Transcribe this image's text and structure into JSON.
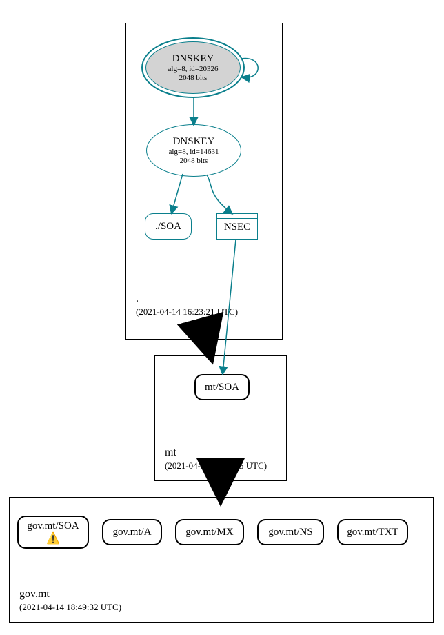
{
  "zones": {
    "root": {
      "label": ".",
      "timestamp": "(2021-04-14 16:23:21 UTC)",
      "ksk": {
        "title": "DNSKEY",
        "alg": "alg=8, id=20326",
        "bits": "2048 bits"
      },
      "zsk": {
        "title": "DNSKEY",
        "alg": "alg=8, id=14631",
        "bits": "2048 bits"
      },
      "soa": "./SOA",
      "nsec": "NSEC"
    },
    "mt": {
      "label": "mt",
      "timestamp": "(2021-04-14 18:49:25 UTC)",
      "soa": "mt/SOA"
    },
    "govmt": {
      "label": "gov.mt",
      "timestamp": "(2021-04-14 18:49:32 UTC)",
      "records": {
        "soa": "gov.mt/SOA",
        "a": "gov.mt/A",
        "mx": "gov.mt/MX",
        "ns": "gov.mt/NS",
        "txt": "gov.mt/TXT"
      }
    }
  }
}
